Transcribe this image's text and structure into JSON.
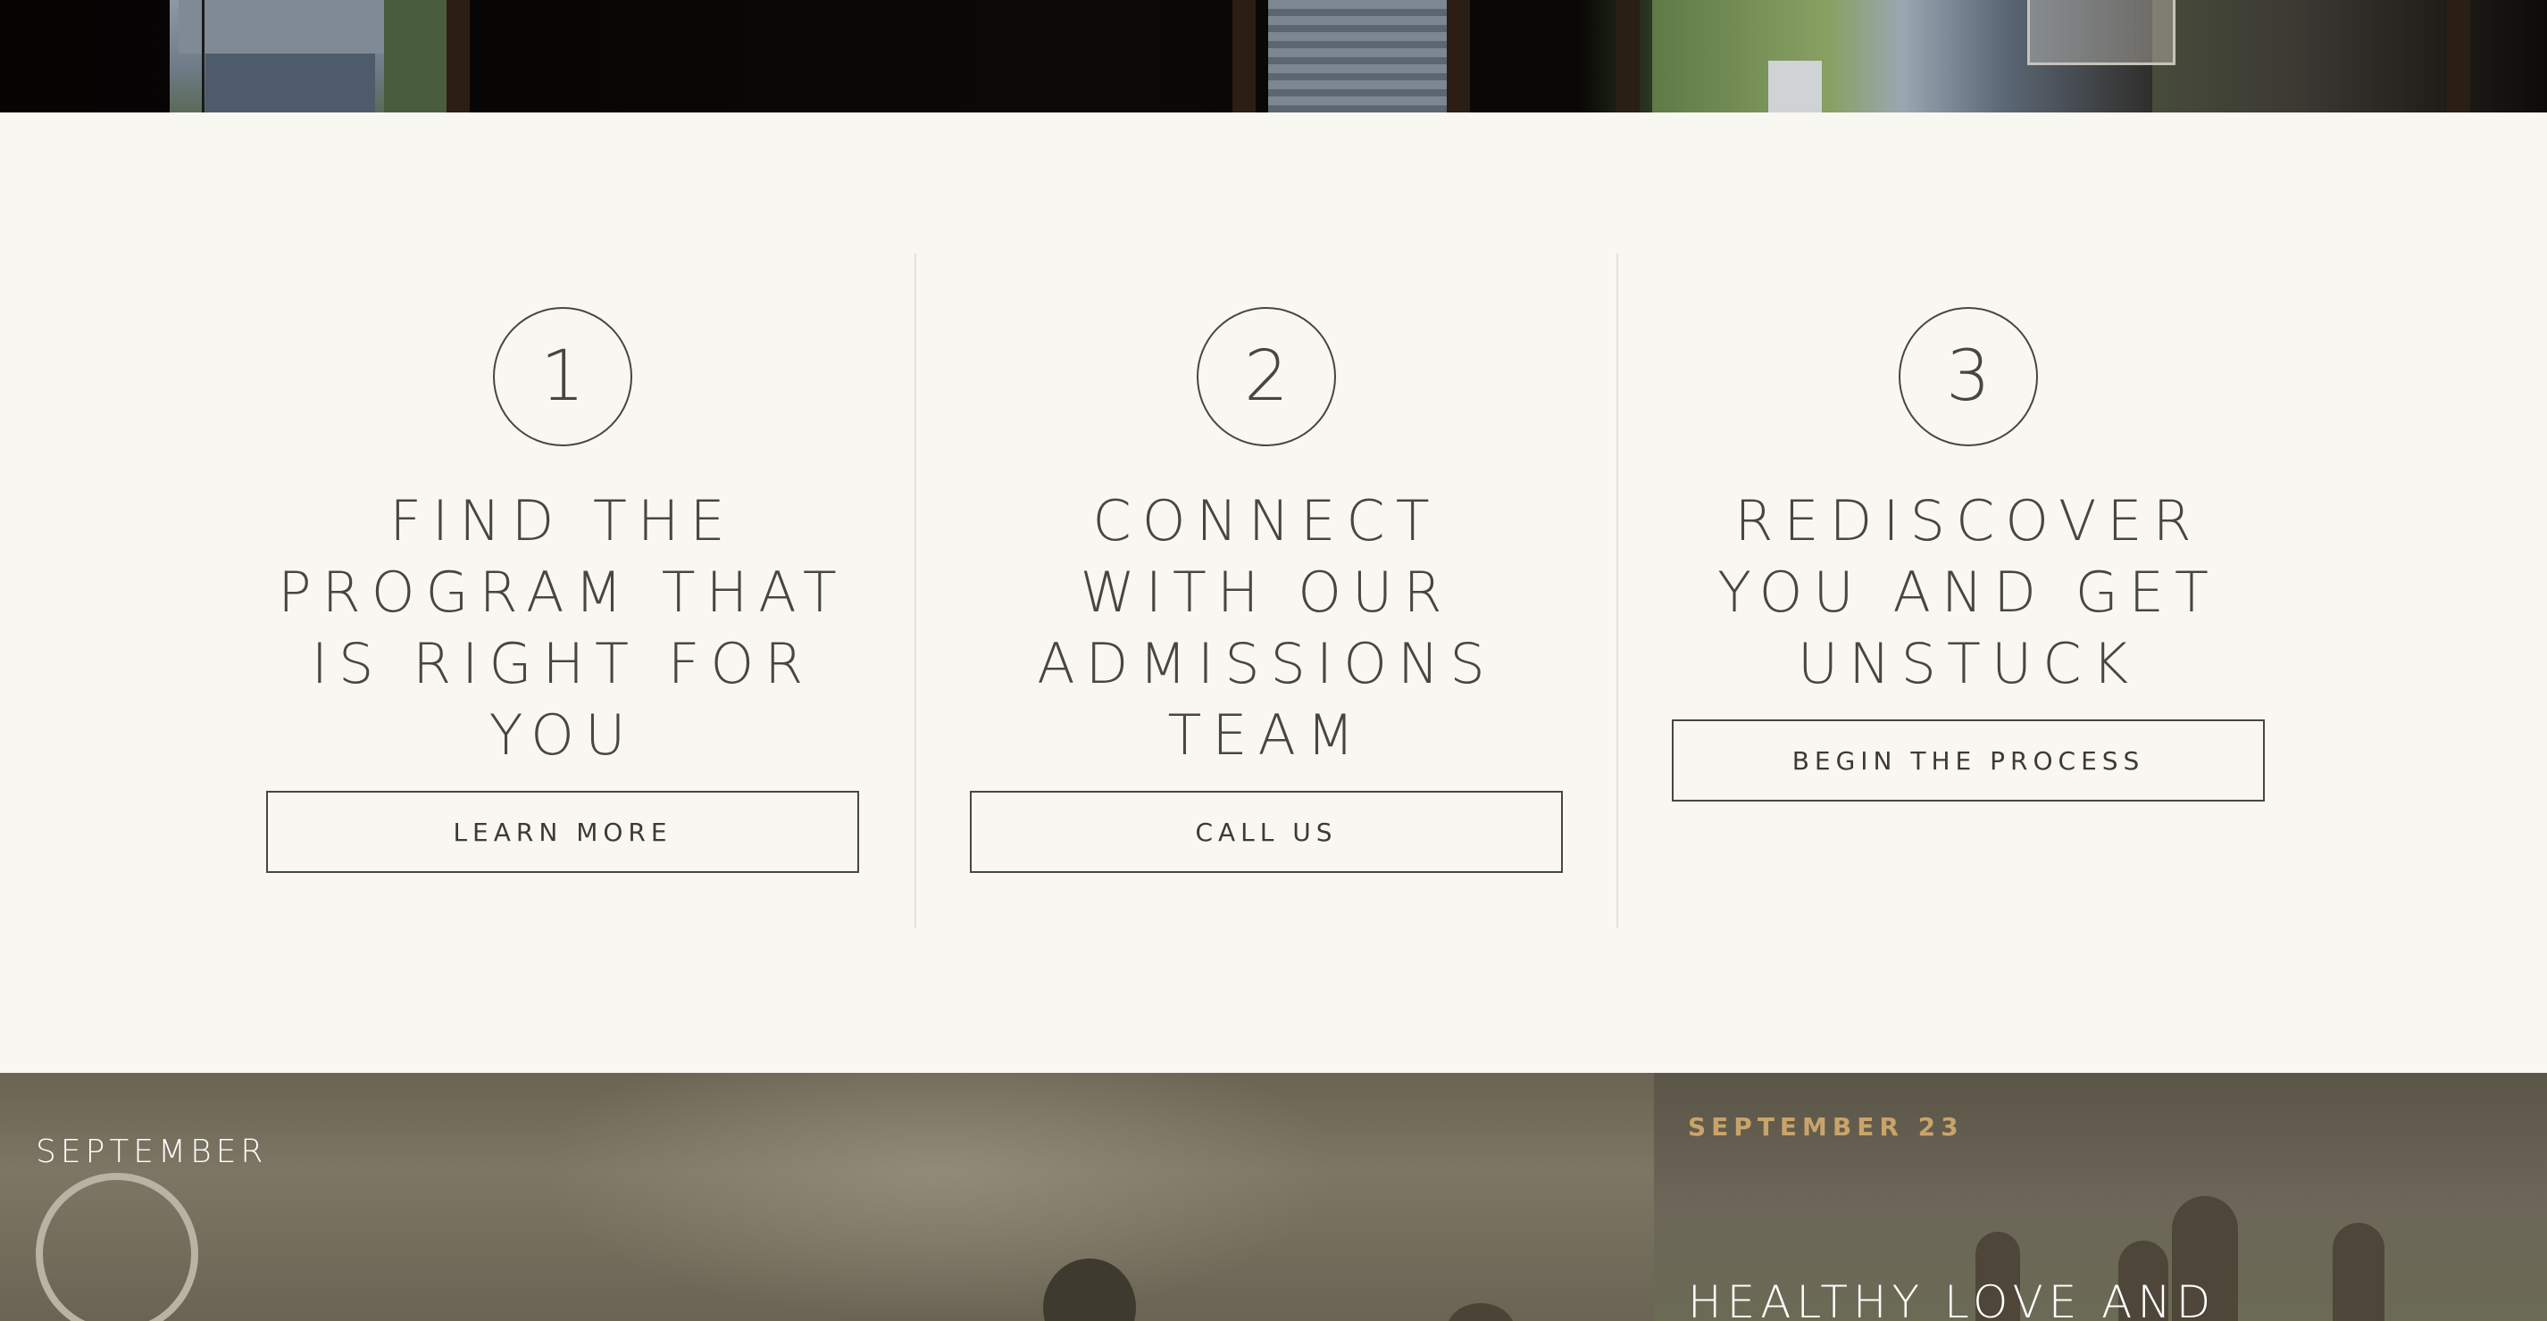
{
  "steps": [
    {
      "number": "1",
      "title": "FIND THE PROGRAM THAT IS RIGHT FOR YOU",
      "button": "LEARN MORE"
    },
    {
      "number": "2",
      "title": "CONNECT WITH OUR ADMISSIONS TEAM",
      "button": "CALL US"
    },
    {
      "number": "3",
      "title": "REDISCOVER YOU AND GET UNSTUCK",
      "button": "BEGIN THE PROCESS"
    }
  ],
  "events": {
    "month_label": "SEPTEMBER",
    "featured": {
      "date": "SEPTEMBER 23",
      "title": "HEALTHY LOVE AND"
    }
  },
  "colors": {
    "background": "#f8f7f2",
    "text": "#4a463f",
    "accent_gold": "#c9a46a"
  }
}
